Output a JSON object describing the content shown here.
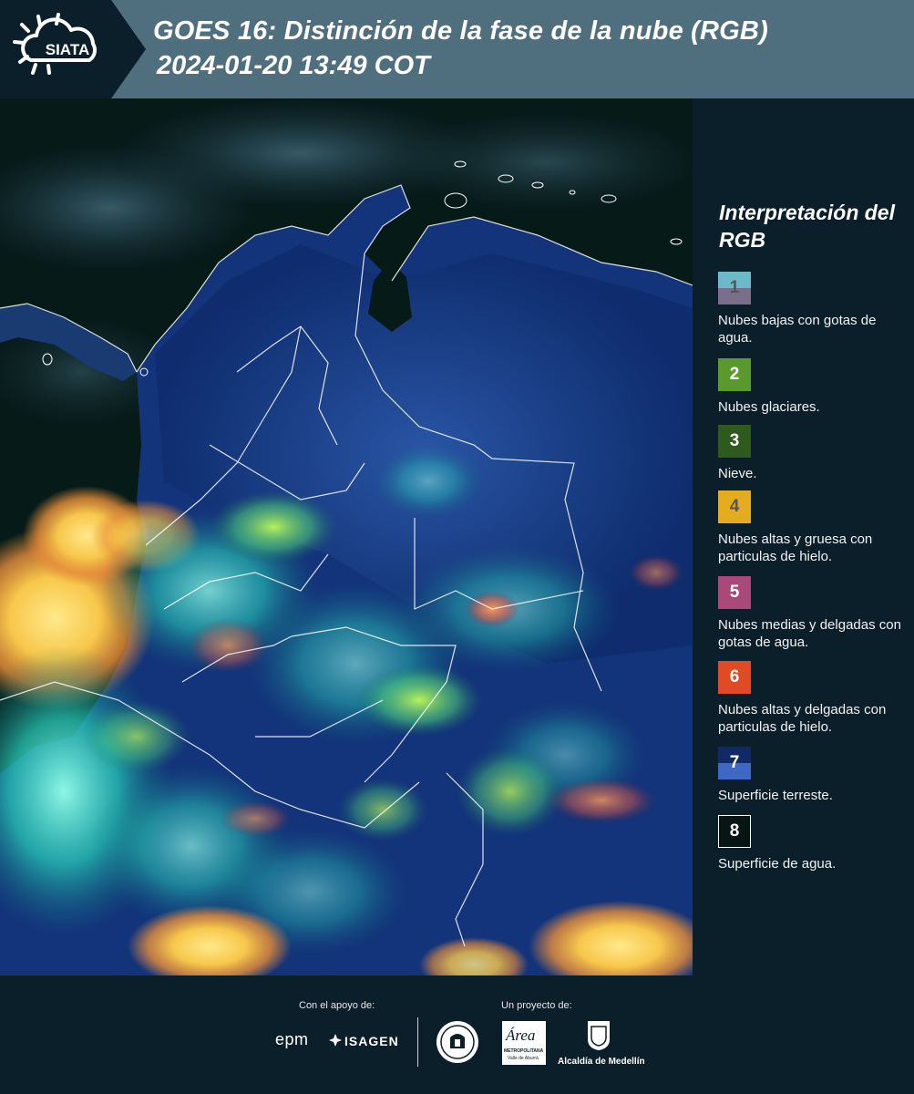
{
  "header": {
    "logo_text": "SIATA",
    "title": "GOES 16: Distinción de la fase de la nube (RGB)",
    "timestamp": "2024-01-20 13:49 COT"
  },
  "legend": {
    "title": "Interpretación del RGB",
    "items": [
      {
        "number": "1",
        "label": "Nubes bajas con gotas de agua.",
        "color_top": "#6bb9c9",
        "color_bottom": "#7a6e8a",
        "text_color": "#555555"
      },
      {
        "number": "2",
        "label": "Nubes glaciares.",
        "color": "#5a9a2c",
        "text_color": "#ffffff"
      },
      {
        "number": "3",
        "label": "Nieve.",
        "color": "#2f5a1e",
        "text_color": "#ffffff"
      },
      {
        "number": "4",
        "label": "Nubes altas y gruesa con particulas de hielo.",
        "color": "#e3ad1f",
        "text_color": "#555555"
      },
      {
        "number": "5",
        "label": "Nubes medias y delgadas con gotas de agua.",
        "color": "#a8497a",
        "text_color": "#ffffff"
      },
      {
        "number": "6",
        "label": "Nubes altas y delgadas con particulas de hielo.",
        "color": "#e04b25",
        "text_color": "#ffffff"
      },
      {
        "number": "7",
        "label": "Superficie terreste.",
        "color_top": "#0f2a66",
        "color_bottom": "#3f68c4",
        "text_color": "#ffffff"
      },
      {
        "number": "8",
        "label": "Superficie de agua.",
        "color": "#071613",
        "text_color": "#ffffff",
        "border": "#ffffff"
      }
    ]
  },
  "footer": {
    "support_label": "Con el apoyo de:",
    "project_label": "Un proyecto de:",
    "sponsor_epm": "epm",
    "sponsor_isagen": "ISAGEN",
    "partner_area_main": "Área",
    "partner_area_sub": "METROPOLITANA",
    "partner_area_sub2": "Valle de Aburrá",
    "partner_alcaldia": "Alcaldía de Medellín"
  },
  "colors": {
    "header_bg": "#4f6e7e",
    "panel_bg": "#0b1f2b"
  }
}
